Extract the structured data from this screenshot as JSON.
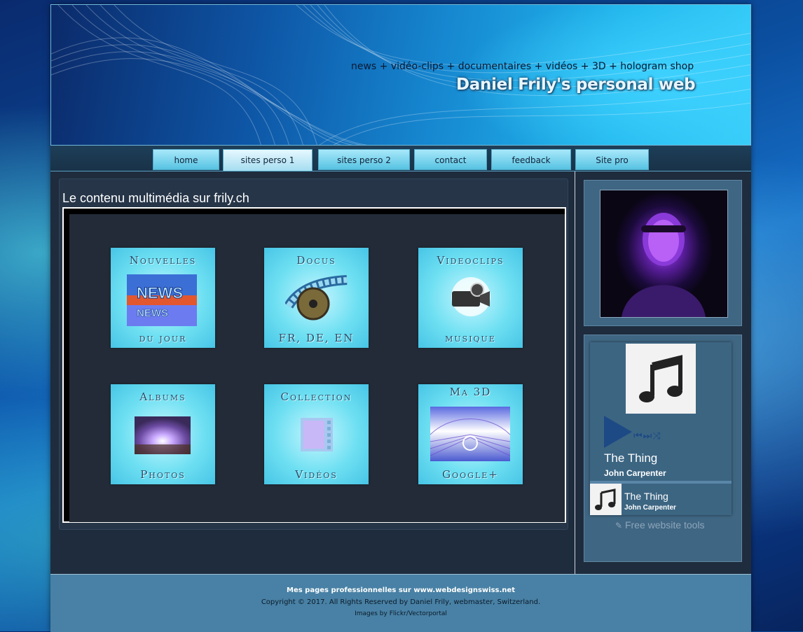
{
  "header": {
    "tagline": "news + vidéo-clips + documentaires + vidéos + 3D + hologram shop",
    "title": "Daniel Frily's personal web"
  },
  "nav": {
    "items": [
      {
        "label": "home"
      },
      {
        "label": "sites perso 1",
        "active": true
      },
      {
        "label": "sites perso 2"
      },
      {
        "label": "contact"
      },
      {
        "label": "feedback"
      },
      {
        "label": "Site pro"
      }
    ]
  },
  "main": {
    "title": "Le contenu multimédia sur frily.ch",
    "tiles": [
      {
        "top": "Nouvelles",
        "bottom": "du jour",
        "image": "news-image"
      },
      {
        "top": "Docus",
        "bottom": "FR, DE, EN",
        "image": "film-reel-image"
      },
      {
        "top": "Videoclips",
        "bottom": "musique",
        "image": "film-camera-image"
      },
      {
        "top": "Albums",
        "bottom": "Photos",
        "image": "landscape-image"
      },
      {
        "top": "Collection",
        "bottom": "Vidéos",
        "image": "filmstrip-image"
      },
      {
        "top": "Ma 3D",
        "bottom": "Google+",
        "image": "3d-image"
      }
    ]
  },
  "sidebar": {
    "player": {
      "song_title": "The Thing",
      "artist": "John Carpenter",
      "track": {
        "title": "The Thing",
        "artist": "John Carpenter"
      },
      "tools_label": "Free website tools"
    }
  },
  "footer": {
    "line1": "Mes pages professionnelles sur www.webdesignswiss.net",
    "line2": "Copyright © 2017. All Rights Reserved by Daniel Frily, webmaster, Switzerland.",
    "line3": "Images by Flickr/Vectorportal"
  },
  "colors": {
    "nav_tab": "#56c3e2",
    "tile": "#6fe0f2",
    "footer": "#4881a5",
    "panel": "#3f6683"
  }
}
